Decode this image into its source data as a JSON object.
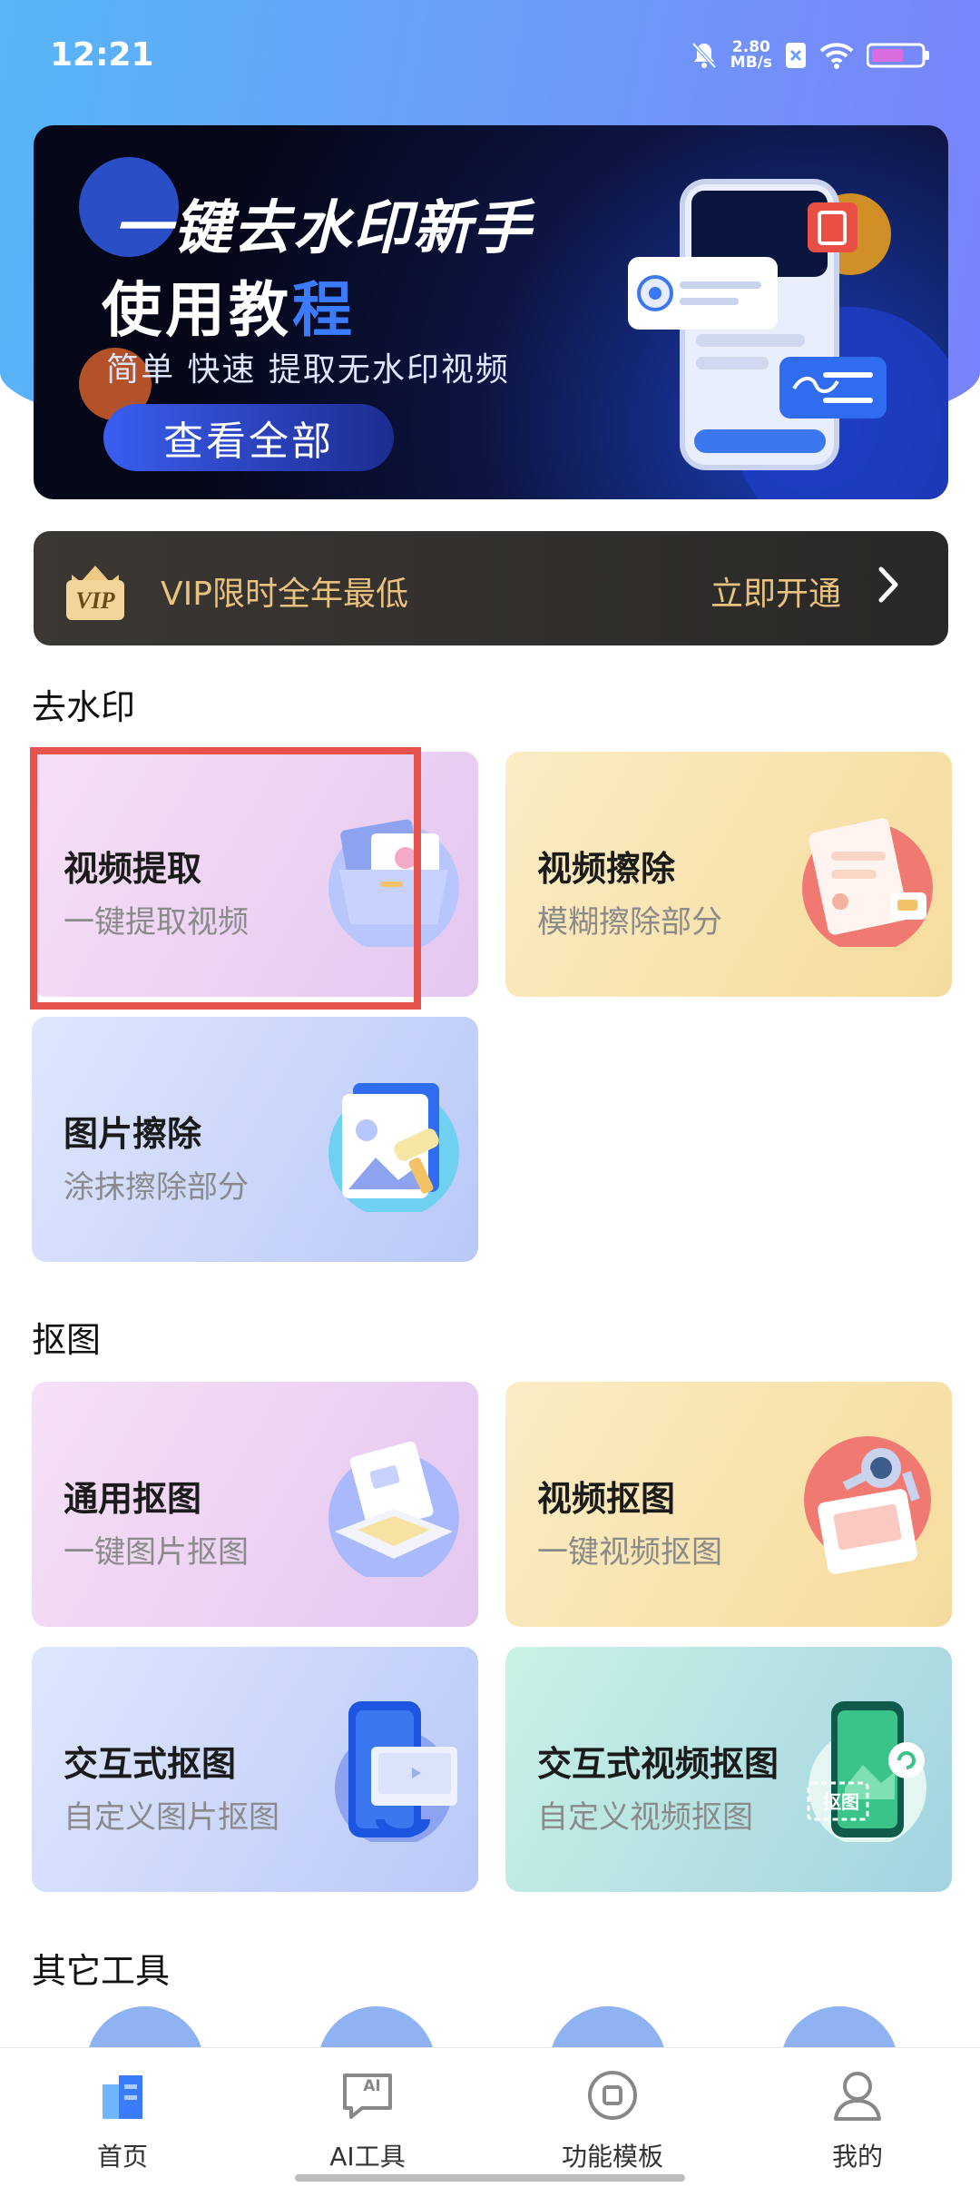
{
  "status": {
    "time": "12:21",
    "speed_value": "2.80",
    "speed_unit": "MB/s"
  },
  "banner": {
    "title_line1": "一键去水印新手",
    "title_line2_a": "使用教",
    "title_line2_b": "程",
    "subtitle": "简单 快速 提取无水印视频",
    "button": "查看全部"
  },
  "vip": {
    "badge": "VIP",
    "text": "VIP限时全年最低",
    "action": "立即开通"
  },
  "sections": {
    "watermark": {
      "title": "去水印",
      "cards": [
        {
          "title": "视频提取",
          "subtitle": "一键提取视频"
        },
        {
          "title": "视频擦除",
          "subtitle": "模糊擦除部分"
        },
        {
          "title": "图片擦除",
          "subtitle": "涂抹擦除部分"
        }
      ]
    },
    "cutout": {
      "title": "抠图",
      "cards": [
        {
          "title": "通用抠图",
          "subtitle": "一键图片抠图"
        },
        {
          "title": "视频抠图",
          "subtitle": "一键视频抠图"
        },
        {
          "title": "交互式抠图",
          "subtitle": "自定义图片抠图"
        },
        {
          "title": "交互式视频抠图",
          "subtitle": "自定义视频抠图",
          "art_label": "抠图"
        }
      ]
    },
    "other": {
      "title": "其它工具"
    }
  },
  "tabs": [
    {
      "label": "首页",
      "icon": "home-building-icon"
    },
    {
      "label": "AI工具",
      "icon": "ai-chat-icon",
      "icon_text": "AI"
    },
    {
      "label": "功能模板",
      "icon": "template-icon"
    },
    {
      "label": "我的",
      "icon": "profile-icon"
    }
  ],
  "colors": {
    "accent_blue": "#3b7cff",
    "vip_gold": "#e9c27f",
    "highlight_red": "#e8524c"
  }
}
